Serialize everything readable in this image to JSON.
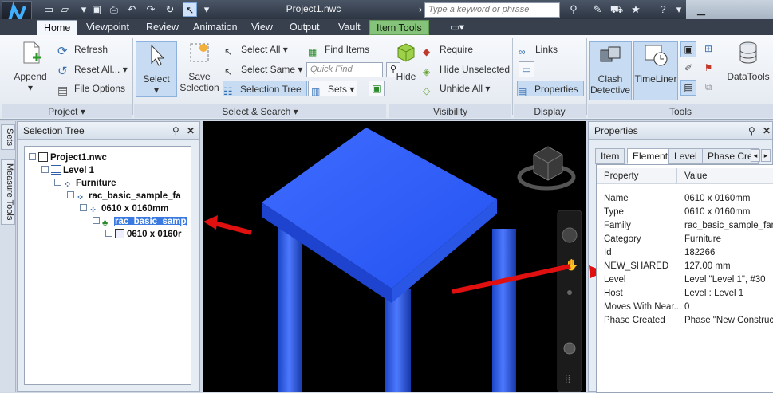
{
  "titlebar": {
    "doc_title": "Project1.nwc",
    "search_placeholder": "Type a keyword or phrase"
  },
  "tabs": [
    {
      "label": "Home"
    },
    {
      "label": "Viewpoint"
    },
    {
      "label": "Review"
    },
    {
      "label": "Animation"
    },
    {
      "label": "View"
    },
    {
      "label": "Output"
    },
    {
      "label": "Vault"
    },
    {
      "label": "Item Tools"
    }
  ],
  "ribbon": {
    "project": {
      "append": "Append",
      "refresh": "Refresh",
      "reset_all": "Reset All...",
      "file_options": "File Options",
      "label": "Project ▾"
    },
    "select_search": {
      "select": "Select",
      "save_selection": "Save Selection",
      "select_all": "Select All",
      "select_same": "Select Same",
      "selection_tree": "Selection Tree",
      "find_items": "Find Items",
      "quick_find_placeholder": "Quick Find",
      "sets": "Sets",
      "label": "Select & Search ▾"
    },
    "visibility": {
      "hide": "Hide",
      "require": "Require",
      "hide_unselected": "Hide Unselected",
      "unhide_all": "Unhide All",
      "label": "Visibility"
    },
    "display": {
      "links": "Links",
      "properties": "Properties",
      "label": "Display"
    },
    "tools": {
      "clash_detective": "Clash Detective",
      "timeliner": "TimeLiner",
      "datatools": "DataTools",
      "label": "Tools"
    }
  },
  "side_tabs": [
    "Sets",
    "Measure Tools"
  ],
  "selection_tree": {
    "title": "Selection Tree",
    "nodes": [
      {
        "label": "Project1.nwc"
      },
      {
        "label": "Level 1"
      },
      {
        "label": "Furniture"
      },
      {
        "label": "rac_basic_sample_fa"
      },
      {
        "label": "0610 x 0160mm"
      },
      {
        "label": "rac_basic_samp"
      },
      {
        "label": "0610 x 0160r"
      }
    ]
  },
  "properties": {
    "title": "Properties",
    "tabs": [
      "Item",
      "Element",
      "Level",
      "Phase Cre"
    ],
    "header": {
      "property": "Property",
      "value": "Value"
    },
    "rows": [
      {
        "k": "Name",
        "v": "0610 x 0160mm"
      },
      {
        "k": "Type",
        "v": "0610 x 0160mm"
      },
      {
        "k": "Family",
        "v": "rac_basic_sample_fam"
      },
      {
        "k": "Category",
        "v": "Furniture"
      },
      {
        "k": "Id",
        "v": "182266"
      },
      {
        "k": "NEW_SHARED",
        "v": "127.00 mm"
      },
      {
        "k": "Level",
        "v": "Level \"Level 1\", #30"
      },
      {
        "k": "Host",
        "v": "Level : Level 1"
      },
      {
        "k": "Moves With Near...",
        "v": "0"
      },
      {
        "k": "Phase Created",
        "v": "Phase \"New Construct"
      }
    ]
  },
  "colors": {
    "accent": "#3a7ae0",
    "model_blue": "#2255ee",
    "arrow_red": "#e01010",
    "context_tab": "#86c37a"
  }
}
